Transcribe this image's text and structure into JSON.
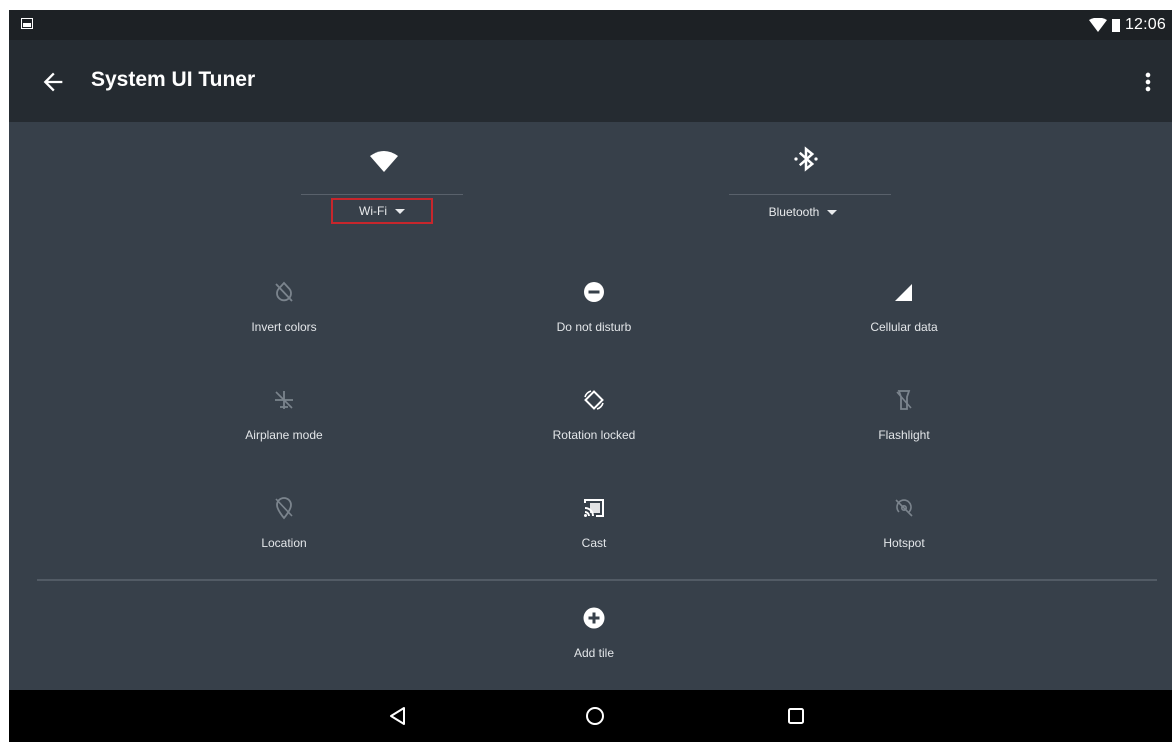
{
  "status_bar": {
    "time": "12:06",
    "left_icon": "notification-image-icon",
    "wifi_icon": "wifi-signal-icon",
    "battery_icon": "battery-icon"
  },
  "app_bar": {
    "title": "System UI Tuner",
    "back_icon": "arrow-back-icon",
    "menu_icon": "more-vert-icon"
  },
  "top_tiles": [
    {
      "icon": "wifi-icon",
      "label": "Wi-Fi"
    },
    {
      "icon": "bluetooth-icon",
      "label": "Bluetooth"
    }
  ],
  "tiles": [
    {
      "icon": "invert-colors-icon",
      "label": "Invert colors"
    },
    {
      "icon": "do-not-disturb-icon",
      "label": "Do not disturb"
    },
    {
      "icon": "cellular-data-icon",
      "label": "Cellular data"
    },
    {
      "icon": "airplane-mode-icon",
      "label": "Airplane mode"
    },
    {
      "icon": "rotation-locked-icon",
      "label": "Rotation locked"
    },
    {
      "icon": "flashlight-icon",
      "label": "Flashlight"
    },
    {
      "icon": "location-icon",
      "label": "Location"
    },
    {
      "icon": "cast-icon",
      "label": "Cast"
    },
    {
      "icon": "hotspot-icon",
      "label": "Hotspot"
    }
  ],
  "add_tile": {
    "icon": "add-circle-icon",
    "label": "Add tile"
  },
  "nav_bar": {
    "back_icon": "nav-back-icon",
    "home_icon": "nav-home-icon",
    "recents_icon": "nav-recents-icon"
  },
  "colors": {
    "background": "#37404a",
    "app_bar": "#252b31",
    "status_bar": "#1d2125",
    "highlight": "#c7262c"
  }
}
